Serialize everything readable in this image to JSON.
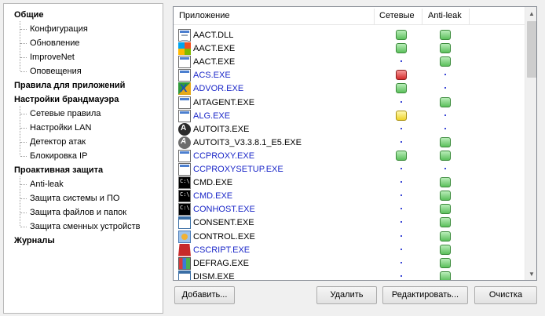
{
  "tree": {
    "categories": [
      {
        "label": "Общие",
        "children": [
          "Конфигурация",
          "Обновление",
          "ImproveNet",
          "Оповещения"
        ]
      },
      {
        "label": "Правила для приложений",
        "children": []
      },
      {
        "label": "Настройки брандмауэра",
        "children": [
          "Сетевые правила",
          "Настройки LAN",
          "Детектор атак",
          "Блокировка IP"
        ]
      },
      {
        "label": "Проактивная защита",
        "children": [
          "Anti-leak",
          "Защита системы и ПО",
          "Защита файлов и папок",
          "Защита сменных устройств"
        ]
      },
      {
        "label": "Журналы",
        "children": []
      }
    ]
  },
  "list": {
    "columns": {
      "app": "Приложение",
      "net": "Сетевые",
      "antileak": "Anti-leak"
    },
    "rows": [
      {
        "name": "AACT.DLL",
        "icon": "dll-file-icon",
        "net": "allow",
        "antileak": "allow",
        "blue": false
      },
      {
        "name": "AACT.EXE",
        "icon": "windows-logo-icon",
        "net": "allow",
        "antileak": "allow",
        "blue": false
      },
      {
        "name": "AACT.EXE",
        "icon": "exe-file-icon",
        "net": "none",
        "antileak": "allow",
        "blue": false
      },
      {
        "name": "ACS.EXE",
        "icon": "exe-file-icon",
        "net": "block",
        "antileak": "none",
        "blue": true
      },
      {
        "name": "ADVOR.EXE",
        "icon": "advor-app-icon",
        "net": "allow",
        "antileak": "none",
        "blue": true
      },
      {
        "name": "AITAGENT.EXE",
        "icon": "exe-file-icon",
        "net": "none",
        "antileak": "allow",
        "blue": false
      },
      {
        "name": "ALG.EXE",
        "icon": "exe-file-icon",
        "net": "ask",
        "antileak": "none",
        "blue": true
      },
      {
        "name": "AUTOIT3.EXE",
        "icon": "autoit-icon",
        "net": "none",
        "antileak": "none",
        "blue": false
      },
      {
        "name": "AUTOIT3_V3.3.8.1_E5.EXE",
        "icon": "autoit-setup-icon",
        "net": "none",
        "antileak": "allow",
        "blue": false
      },
      {
        "name": "CCPROXY.EXE",
        "icon": "exe-file-icon",
        "net": "allow",
        "antileak": "allow",
        "blue": true
      },
      {
        "name": "CCPROXYSETUP.EXE",
        "icon": "exe-file-icon",
        "net": "none",
        "antileak": "none",
        "blue": true
      },
      {
        "name": "CMD.EXE",
        "icon": "cmd-icon",
        "net": "none",
        "antileak": "allow",
        "blue": false
      },
      {
        "name": "CMD.EXE",
        "icon": "cmd-icon",
        "net": "none",
        "antileak": "allow",
        "blue": true
      },
      {
        "name": "CONHOST.EXE",
        "icon": "cmd-icon",
        "net": "none",
        "antileak": "allow",
        "blue": true
      },
      {
        "name": "CONSENT.EXE",
        "icon": "window-icon",
        "net": "none",
        "antileak": "allow",
        "blue": false
      },
      {
        "name": "CONTROL.EXE",
        "icon": "control-panel-icon",
        "net": "none",
        "antileak": "allow",
        "blue": false
      },
      {
        "name": "CSCRIPT.EXE",
        "icon": "script-icon",
        "net": "none",
        "antileak": "allow",
        "blue": true
      },
      {
        "name": "DEFRAG.EXE",
        "icon": "defrag-icon",
        "net": "none",
        "antileak": "allow",
        "blue": false
      },
      {
        "name": "DISM.EXE",
        "icon": "window-icon",
        "net": "none",
        "antileak": "allow",
        "blue": false
      }
    ]
  },
  "buttons": {
    "add": "Добавить...",
    "delete": "Удалить",
    "edit": "Редактировать...",
    "clear": "Очистка"
  },
  "colors": {
    "blue_text": "#1b27c8",
    "status_allow": "#5cc05c",
    "status_block": "#d32b2b",
    "status_ask": "#eed22a"
  }
}
